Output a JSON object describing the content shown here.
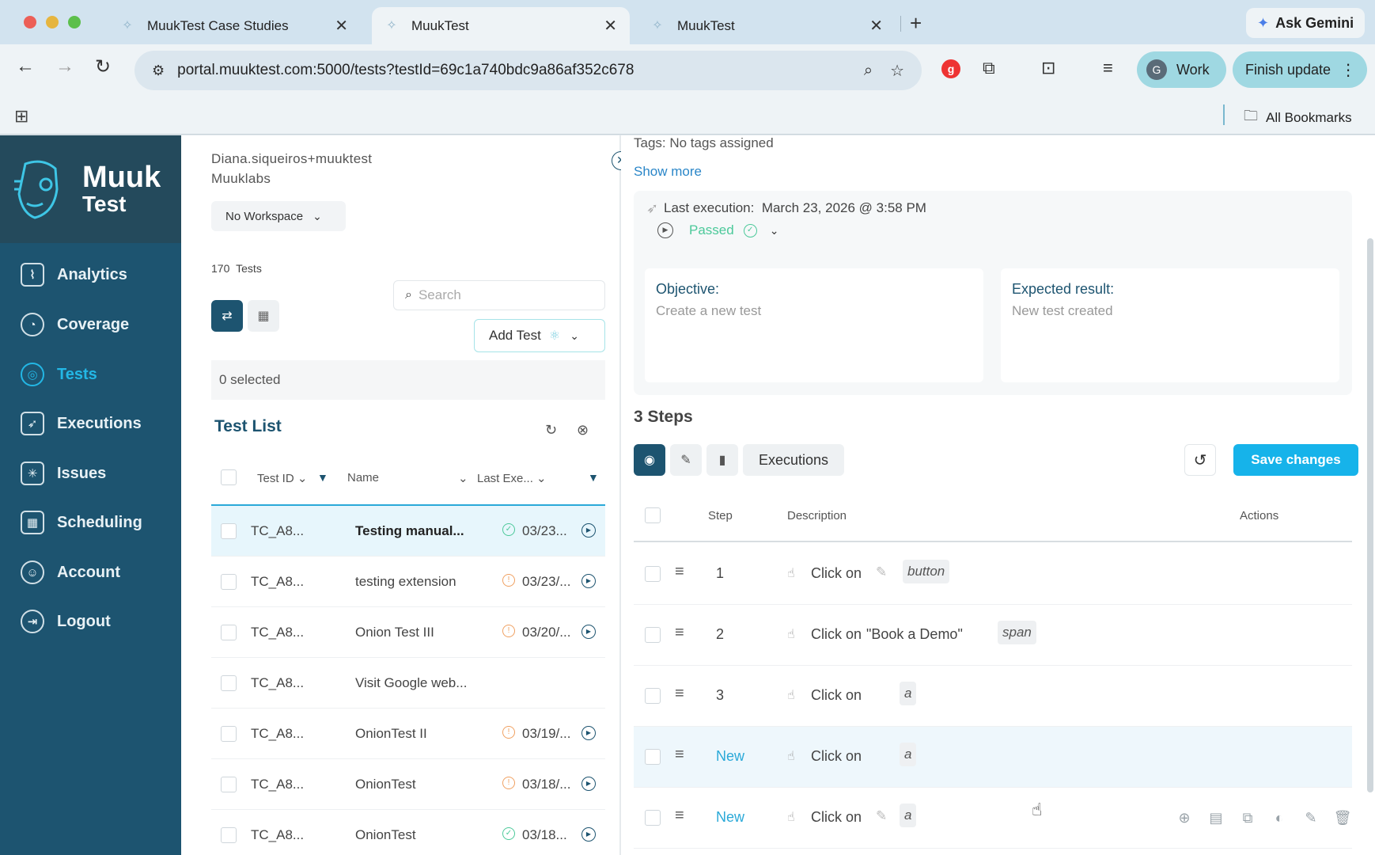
{
  "browser": {
    "tabs": [
      {
        "title": "MuukTest Case Studies",
        "active": false
      },
      {
        "title": "MuukTest",
        "active": true
      },
      {
        "title": "MuukTest",
        "active": false
      }
    ],
    "ask_gemini": "Ask Gemini",
    "url": "portal.muuktest.com:5000/tests?testId=69c1a740bdc9a86af352c678",
    "profile_initial": "G",
    "profile_label": "Work",
    "finish_update": "Finish update",
    "all_bookmarks": "All Bookmarks",
    "colors": {
      "tabbar": "#d2e3ef",
      "chrome_pill": "#9fd8e2"
    }
  },
  "sidebar": {
    "logo_line1": "Muuk",
    "logo_line2": "Test",
    "items": [
      {
        "label": "Analytics",
        "icon": "analytics-icon",
        "active": false
      },
      {
        "label": "Coverage",
        "icon": "coverage-icon",
        "active": false
      },
      {
        "label": "Tests",
        "icon": "tests-icon",
        "active": true
      },
      {
        "label": "Executions",
        "icon": "rocket-icon",
        "active": false
      },
      {
        "label": "Issues",
        "icon": "bug-icon",
        "active": false
      },
      {
        "label": "Scheduling",
        "icon": "calendar-icon",
        "active": false
      },
      {
        "label": "Account",
        "icon": "user-icon",
        "active": false
      },
      {
        "label": "Logout",
        "icon": "logout-icon",
        "active": false
      }
    ],
    "colors": {
      "bg": "#1d5470",
      "active": "#23b7e5"
    }
  },
  "list": {
    "user_name": "Diana.siqueiros+muuktest",
    "org": "Muuklabs",
    "workspace": "No Workspace",
    "count": "170",
    "count_label": "Tests",
    "search_placeholder": "Search",
    "add_test": "Add Test",
    "selected": "0 selected",
    "title": "Test List",
    "columns": {
      "id": "Test ID",
      "name": "Name",
      "last": "Last Exe..."
    },
    "rows": [
      {
        "id": "TC_A8...",
        "name": "Testing manual...",
        "status": "pass",
        "date": "03/23...",
        "selected": true
      },
      {
        "id": "TC_A8...",
        "name": "testing extension",
        "status": "fail",
        "date": "03/23/...",
        "selected": false
      },
      {
        "id": "TC_A8...",
        "name": "Onion Test III",
        "status": "fail",
        "date": "03/20/...",
        "selected": false
      },
      {
        "id": "TC_A8...",
        "name": "Visit Google web...",
        "status": "",
        "date": "",
        "selected": false
      },
      {
        "id": "TC_A8...",
        "name": "OnionTest II",
        "status": "fail",
        "date": "03/19/...",
        "selected": false
      },
      {
        "id": "TC_A8...",
        "name": "OnionTest",
        "status": "fail",
        "date": "03/18/...",
        "selected": false
      },
      {
        "id": "TC_A8...",
        "name": "OnionTest",
        "status": "pass",
        "date": "03/18...",
        "selected": false
      }
    ]
  },
  "detail": {
    "tags": "Tags: No tags assigned",
    "show_more": "Show more",
    "last_execution_label": "Last execution:",
    "last_execution_date": "March 23, 2026 @ 3:58 PM",
    "status": "Passed",
    "objective_title": "Objective:",
    "objective_text": "Create a new test",
    "expected_title": "Expected result:",
    "expected_text": "New test created",
    "steps_title": "3 Steps",
    "executions_btn": "Executions",
    "save_btn": "Save changes",
    "columns": {
      "step": "Step",
      "description": "Description",
      "actions": "Actions"
    },
    "steps": [
      {
        "num": "1",
        "action": "Click on",
        "target": "",
        "chip": "button",
        "pencil": true,
        "new": false
      },
      {
        "num": "2",
        "action": "Click on",
        "target": "\"Book a Demo\"",
        "chip": "span",
        "pencil": false,
        "new": false
      },
      {
        "num": "3",
        "action": "Click on",
        "target": "",
        "chip": "a",
        "pencil": false,
        "new": false
      },
      {
        "num": "New",
        "action": "Click on",
        "target": "",
        "chip": "a",
        "pencil": false,
        "new": true
      },
      {
        "num": "New",
        "action": "Click on",
        "target": "",
        "chip": "a",
        "pencil": true,
        "new": true
      }
    ],
    "colors": {
      "save": "#16b3ea",
      "new_step": "#2aa9d8",
      "passed": "#4cc99a"
    }
  }
}
